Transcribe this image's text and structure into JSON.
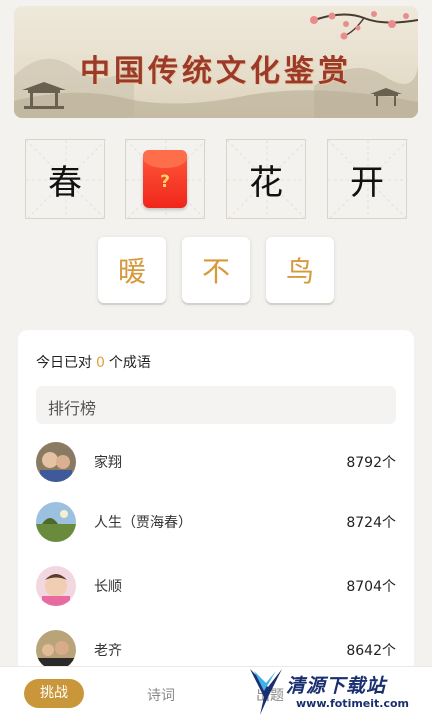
{
  "banner": {
    "title": "中国传统文化鉴赏"
  },
  "puzzle": {
    "chars": [
      "春",
      "",
      "花",
      "开"
    ],
    "hidden_icon": "red-envelope-icon",
    "hidden_mark": "?"
  },
  "options": [
    "暖",
    "不",
    "鸟"
  ],
  "card": {
    "today_prefix": "今日已对",
    "today_count": "0",
    "today_suffix": "个成语",
    "rank_title": "排行榜",
    "leaderboard": [
      {
        "name": "家翔",
        "score": "8792个"
      },
      {
        "name": "人生（贾海春）",
        "score": "8724个"
      },
      {
        "name": "长顺",
        "score": "8704个"
      },
      {
        "name": "老齐",
        "score": "8642个"
      }
    ]
  },
  "nav": {
    "tabs": [
      "挑战",
      "诗词",
      "出题"
    ],
    "active": "挑战"
  },
  "watermark": {
    "text": "清源下载站",
    "url": "www.fotimeit.com"
  },
  "colors": {
    "accent": "#c9973a",
    "option_text": "#d69a3c",
    "banner_title": "#9c3a2a",
    "envelope": "#f0261b"
  }
}
